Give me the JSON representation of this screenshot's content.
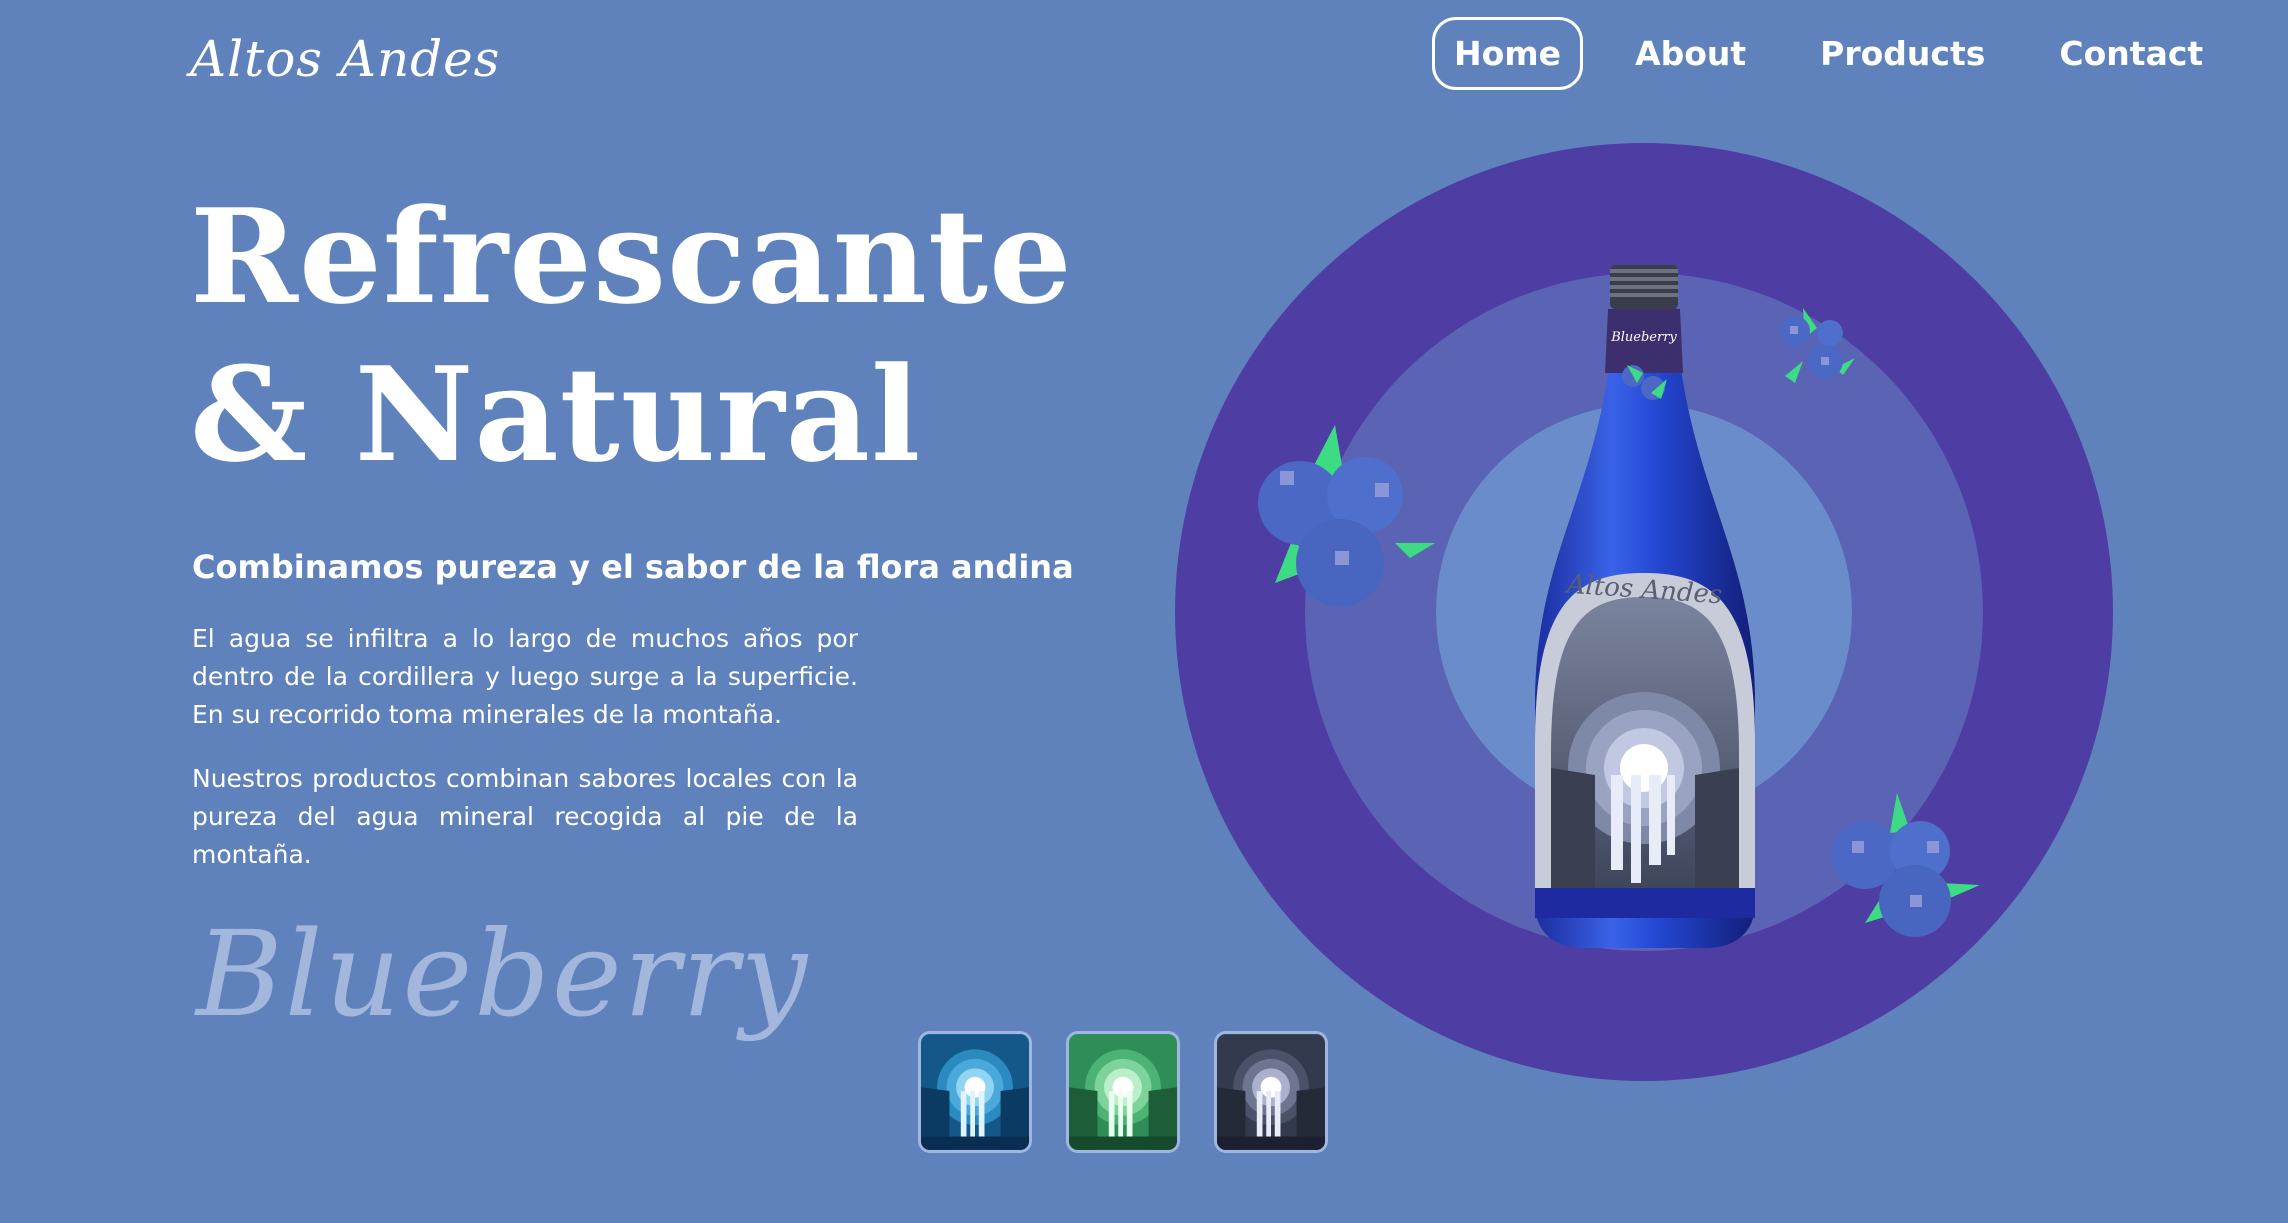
{
  "brand": {
    "logo": "Altos Andes"
  },
  "nav": {
    "items": [
      {
        "label": "Home",
        "active": true
      },
      {
        "label": "About",
        "active": false
      },
      {
        "label": "Products",
        "active": false
      },
      {
        "label": "Contact",
        "active": false
      }
    ]
  },
  "hero": {
    "headline_line1": "Refrescante",
    "headline_line2": "& Natural",
    "subheading": "Combinamos pureza y el sabor de la flora andina",
    "paragraph1": "El agua se infiltra a lo largo de muchos años por dentro de la cordillera y luego surge a la superficie. En su recorrido toma minerales de la montaña.",
    "paragraph2": "Nuestros productos combinan sabores locales con la pureza del agua mineral recogida al pie de la montaña.",
    "flavor_name": "Blueberry"
  },
  "product": {
    "bottle_flavor_label": "Blueberry",
    "bottle_brand_label": "Altos Andes"
  },
  "thumbnails": [
    {
      "name": "blue-variant",
      "color": "#1e6a9e"
    },
    {
      "name": "green-variant",
      "color": "#3daa6a"
    },
    {
      "name": "dark-variant",
      "color": "#3b4256"
    }
  ],
  "colors": {
    "background": "#5f82bd",
    "ring_outer": "#4e3ea4",
    "ring_middle": "#5b63b4",
    "ring_inner": "#6b8ccb",
    "flavor_text": "#a3b6dc"
  }
}
